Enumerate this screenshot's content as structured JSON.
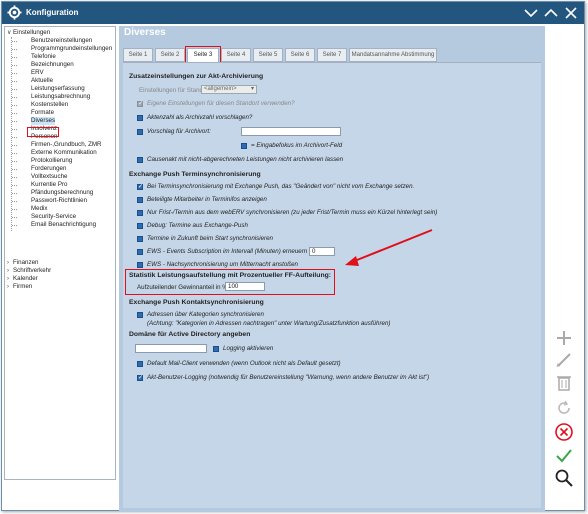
{
  "window": {
    "title": "Konfiguration"
  },
  "tree": {
    "root": "Einstellungen",
    "children": [
      "Benutzereinstellungen",
      "Programmgrundeinstellungen",
      "Telefonie",
      "Bezeichnungen",
      "ERV",
      "Aktuelle",
      "Leistungserfassung",
      "Leistungsabrechnung",
      "Kostenstellen",
      "Formate",
      "Diverses",
      "Insolvenz",
      "Personen",
      "Firmen-,Grundbuch, ZMR",
      "Externe Kommunikation",
      "Protokollierung",
      "Forderungen",
      "Volltextsuche",
      "Kurrentie Pro",
      "Pfändungsberechnung",
      "Passwort-Richtlinien",
      "Medix",
      "Security-Service",
      "Email Benachrichtigung"
    ],
    "selected_index": 10,
    "other_roots": [
      "Finanzen",
      "Schriftverkehr",
      "Kalender",
      "Firmen"
    ]
  },
  "content": {
    "title": "Diverses",
    "tabs": [
      "Seite 1",
      "Seite 2",
      "Seite 3",
      "Seite 4",
      "Seite 5",
      "Seite 6",
      "Seite 7",
      "Mandatsannahme Abstimmung"
    ],
    "active_tab_index": 2
  },
  "sections": {
    "archiv": {
      "heading": "Zusatzeinstellungen zur Akt-Archivierung",
      "standort_label": "Einstellungen für Standort:",
      "standort_value": "<allgemein>",
      "eigene": "Eigene Einstellungen für diesen Standort verwenden?",
      "aktenzahl": "Aktenzahl als Archivzahl vorschlagen?",
      "vorschlag": "Vorschlag für Archivort:",
      "vorschlag_value": "",
      "eingabefokus": "= Eingabefokus im Archivort-Feld",
      "causenakt": "Causenakt mit nicht-abgerechneten Leistungen nicht archivieren lassen"
    },
    "push": {
      "heading": "Exchange Push Terminsynchronisierung",
      "items": [
        "Bei Terminsynchronisierung mit Exchange Push, das \"Geändert von\" nicht vom Exchange setzen.",
        "Beteiligte Mitarbeiter in Terminifos anzeigen",
        "Nur Frist-/Termin aus dem webERV synchronisieren (zu jeder Frist/Termin muss ein Kürzel hinterlegt sein)",
        "Debug: Termine aus Exchange-Push",
        "Termine in Zukunft beim Start synchronisieren",
        "EWS - Events Subscription im Intervall (Minuten) erneuern",
        "EWS - Nachsynchronisierung um Mitternacht anstoßen"
      ],
      "interval_value": "0"
    },
    "statistik": {
      "heading": "Statistik Leistungsaufstellung mit Prozentueller FF-Aufteilung:",
      "label": "Aufzuteilender Gewinnanteil in %",
      "value": "100"
    },
    "kontakt": {
      "heading": "Exchange Push Kontaktsynchronisierung",
      "line1": "Adressen über Kategorien synchronisieren",
      "line2": "(Achtung: \"Kategorien in Adressen nachtragen\" unter Wartung/Zusatzfunktion ausführen)"
    },
    "ad": {
      "heading": "Domäne für Active Directory angeben",
      "domain_value": "",
      "logging": "Logging aktivieren",
      "mail_client": "Default Mail-Client verwenden (wenn Outlook nicht als  Default gesetzt)",
      "akt_benutzer": "Akt-Benutzer-Logging (notwendig für Benutzereinstellung \"Warnung, wenn andere Benutzer im Akt ist\")"
    }
  },
  "colors": {
    "titlebar": "#23567f",
    "panel": "#c5d6e8",
    "highlight": "#e0101a",
    "checkbox": "#2b6cb4"
  },
  "tools": [
    "add-icon",
    "edit-icon",
    "delete-icon",
    "refresh-icon",
    "cancel-icon",
    "confirm-icon",
    "search-icon"
  ]
}
